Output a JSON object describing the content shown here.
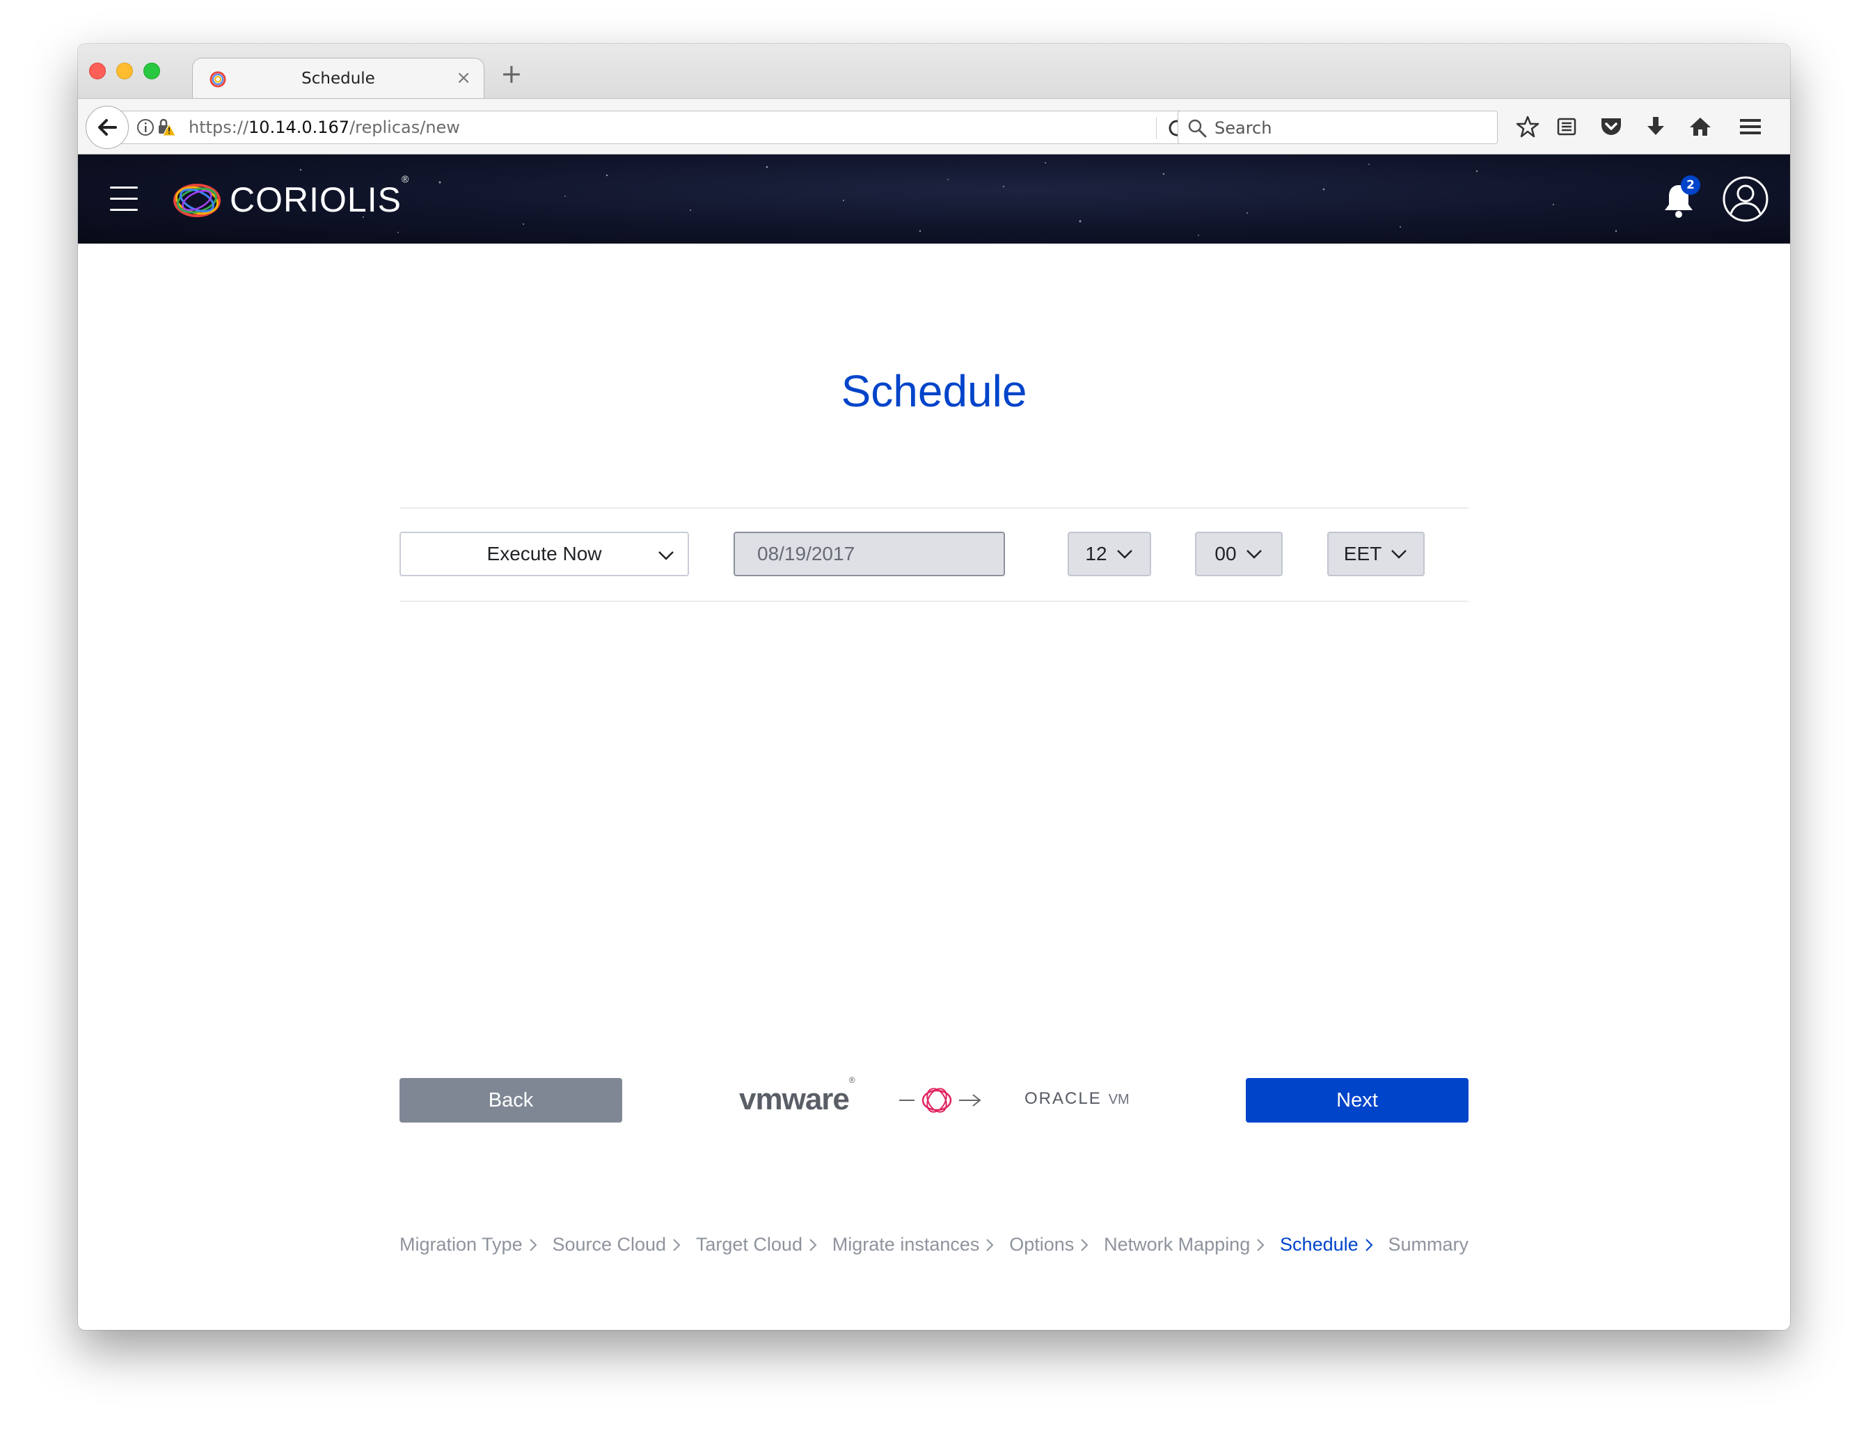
{
  "browser": {
    "tab_title": "Schedule",
    "tab_close": "×",
    "new_tab": "+",
    "url_prefix": "https://",
    "url_host": "10.14.0.167",
    "url_path": "/replicas/new",
    "search_placeholder": "Search"
  },
  "header": {
    "brand": "CORIOLIS",
    "brand_mark": "®",
    "notification_count": "2"
  },
  "page": {
    "title": "Schedule"
  },
  "schedule": {
    "type_value": "Execute Now",
    "date_value": "08/19/2017",
    "hour_value": "12",
    "minute_value": "00",
    "timezone_value": "EET"
  },
  "actions": {
    "back_label": "Back",
    "next_label": "Next"
  },
  "providers": {
    "source": "vmware",
    "target_main": "ORACLE",
    "target_suffix": "VM"
  },
  "wizard_steps": [
    {
      "label": "Migration Type",
      "active": false
    },
    {
      "label": "Source Cloud",
      "active": false
    },
    {
      "label": "Target Cloud",
      "active": false
    },
    {
      "label": "Migrate instances",
      "active": false
    },
    {
      "label": "Options",
      "active": false
    },
    {
      "label": "Network Mapping",
      "active": false
    },
    {
      "label": "Schedule",
      "active": true
    },
    {
      "label": "Summary",
      "active": false
    }
  ],
  "colors": {
    "accent": "#0044ca",
    "header_bg": "#0f1328",
    "back_button": "#7f8795",
    "breadcrumb_inactive": "#8e939d"
  },
  "icons": [
    "back-arrow-icon",
    "info-icon",
    "warning-lock-icon",
    "reload-icon",
    "search-icon",
    "bookmark-star-icon",
    "reading-list-icon",
    "pocket-icon",
    "download-icon",
    "home-icon",
    "menu-icon",
    "hamburger-icon",
    "bell-icon",
    "user-icon",
    "chevron-down-icon",
    "chevron-right-icon"
  ]
}
